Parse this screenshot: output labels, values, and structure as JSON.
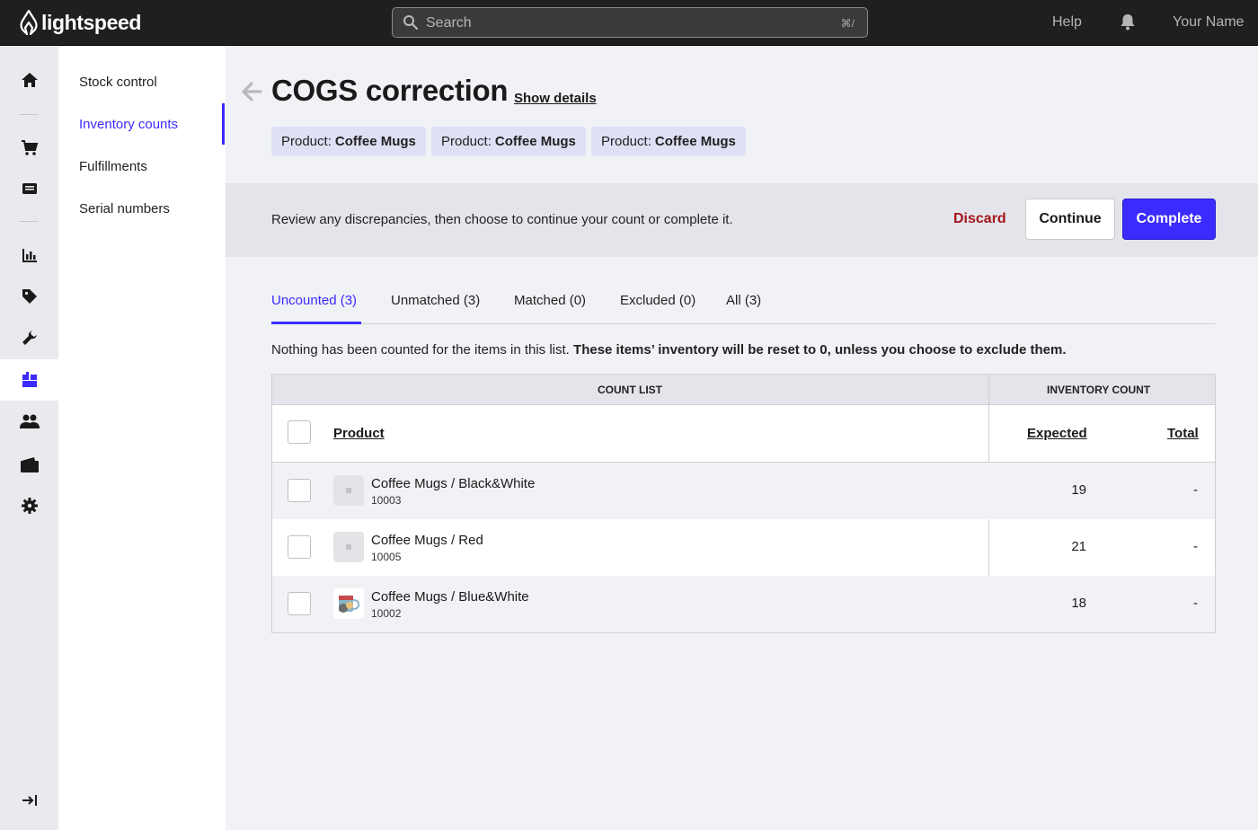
{
  "topbar": {
    "brand": "lightspeed",
    "search_placeholder": "Search",
    "search_shortcut": "⌘/",
    "help": "Help",
    "user_name": "Your Name"
  },
  "rail": {
    "icons": [
      "home-icon",
      "cart-icon",
      "register-icon",
      "reports-icon",
      "tag-icon",
      "wrench-icon",
      "inventory-icon",
      "customers-icon",
      "wallet-icon",
      "settings-icon"
    ],
    "active": "inventory-icon",
    "collapse_icon": "collapse-icon"
  },
  "subnav": {
    "items": [
      {
        "label": "Stock control"
      },
      {
        "label": "Inventory counts"
      },
      {
        "label": "Fulfillments"
      },
      {
        "label": "Serial numbers"
      }
    ],
    "active_index": 1
  },
  "header": {
    "title": "COGS correction",
    "show_details": "Show details",
    "chips": [
      {
        "prefix": "Product:",
        "value": "Coffee Mugs"
      },
      {
        "prefix": "Product:",
        "value": "Coffee Mugs"
      },
      {
        "prefix": "Product:",
        "value": "Coffee Mugs"
      }
    ]
  },
  "banner": {
    "message": "Review any discrepancies, then choose to continue your count or complete it.",
    "discard": "Discard",
    "continue": "Continue",
    "complete": "Complete"
  },
  "tabs": [
    {
      "label": "Uncounted (3)"
    },
    {
      "label": "Unmatched (3)"
    },
    {
      "label": "Matched (0)"
    },
    {
      "label": "Excluded (0)"
    },
    {
      "label": "All (3)"
    }
  ],
  "note": {
    "text": "Nothing has been counted for the items in this list.",
    "bold": "These items’ inventory will be reset to 0, unless you choose to exclude them."
  },
  "table": {
    "group_count_list": "COUNT LIST",
    "group_inventory_count": "INVENTORY COUNT",
    "col_product": "Product",
    "col_expected": "Expected",
    "col_total": "Total",
    "rows": [
      {
        "name": "Coffee Mugs / Black&White",
        "sku": "10003",
        "expected": "19",
        "total": "-"
      },
      {
        "name": "Coffee Mugs / Red",
        "sku": "10005",
        "expected": "21",
        "total": "-"
      },
      {
        "name": "Coffee Mugs / Blue&White",
        "sku": "10002",
        "expected": "18",
        "total": "-"
      }
    ]
  },
  "colors": {
    "accent": "#3b2bff",
    "danger": "#a3161a",
    "topbar": "#1f1f1f"
  }
}
